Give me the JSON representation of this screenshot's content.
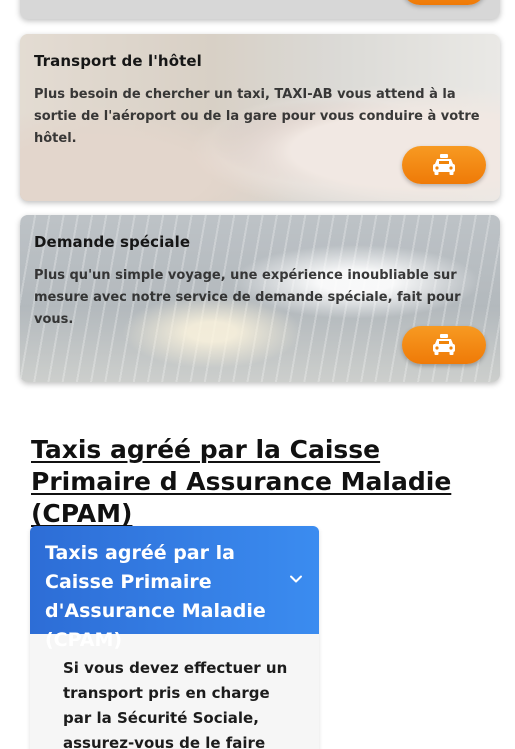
{
  "services": [
    {
      "title": "",
      "description": ""
    },
    {
      "title": "Transport de l'hôtel",
      "description": "Plus besoin de chercher un taxi, TAXI-AB vous attend à la sortie de l'aéroport ou de la gare pour vous conduire à votre hôtel."
    },
    {
      "title": "Demande spéciale",
      "description": "Plus qu'un simple voyage, une expérience inoubliable sur mesure avec notre service de demande spéciale, fait pour vous."
    }
  ],
  "section": {
    "heading": "Taxis agréé par la Caisse Primaire d Assurance Maladie (CPAM)"
  },
  "accordion": {
    "title": "Taxis agréé par la Caisse Primaire d'Assurance Maladie (CPAM)",
    "body": "Si vous devez effectuer un transport pris en charge par la Sécurité Sociale, assurez-vous de le faire avec un taxi"
  },
  "icons": {
    "book_button": "taxi-icon",
    "accordion_toggle": "chevron-down-icon"
  },
  "colors": {
    "accent_orange": "#F28A12",
    "accordion_blue": "#3479E0",
    "heading_text": "#111111"
  }
}
